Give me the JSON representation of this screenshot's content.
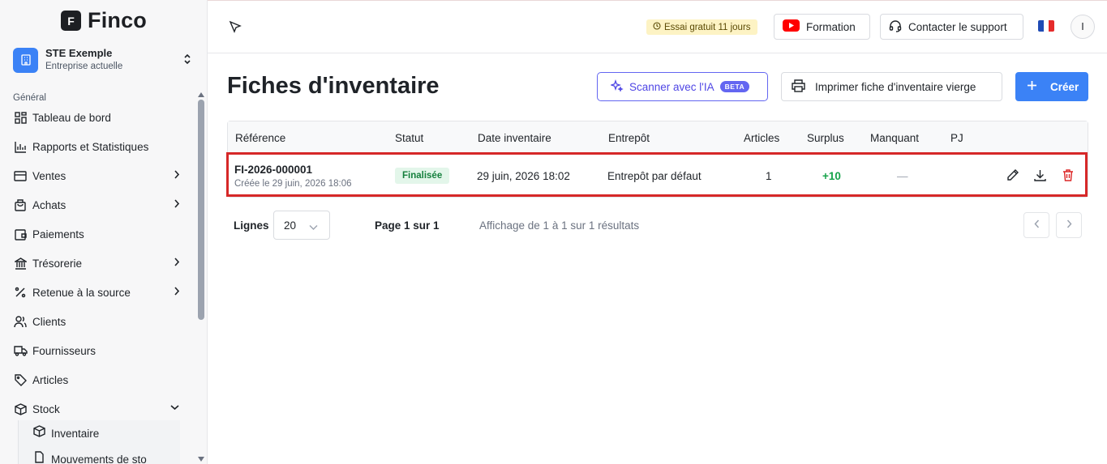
{
  "brand": {
    "logo_letter": "F",
    "name": "Finco"
  },
  "company": {
    "name": "STE Exemple",
    "subtitle": "Entreprise actuelle"
  },
  "sidebar": {
    "section": "Général",
    "items": [
      {
        "label": "Tableau de bord",
        "icon": "dashboard-icon",
        "has_chevron": false
      },
      {
        "label": "Rapports et Statistiques",
        "icon": "bar-chart-icon",
        "has_chevron": false
      },
      {
        "label": "Ventes",
        "icon": "card-icon",
        "has_chevron": true
      },
      {
        "label": "Achats",
        "icon": "bag-icon",
        "has_chevron": true
      },
      {
        "label": "Paiements",
        "icon": "wallet-icon",
        "has_chevron": false
      },
      {
        "label": "Trésorerie",
        "icon": "bank-icon",
        "has_chevron": true
      },
      {
        "label": "Retenue à la source",
        "icon": "percent-icon",
        "has_chevron": true
      },
      {
        "label": "Clients",
        "icon": "users-icon",
        "has_chevron": false
      },
      {
        "label": "Fournisseurs",
        "icon": "truck-icon",
        "has_chevron": false
      },
      {
        "label": "Articles",
        "icon": "tag-icon",
        "has_chevron": false
      },
      {
        "label": "Stock",
        "icon": "box-icon",
        "has_chevron": true,
        "expanded": true
      }
    ],
    "sub_items": [
      {
        "label": "Inventaire",
        "icon": "box-icon"
      },
      {
        "label": "Mouvements de sto",
        "icon": "file-icon"
      }
    ]
  },
  "topbar": {
    "trial": "Essai gratuit 11 jours",
    "formation": "Formation",
    "support": "Contacter le support",
    "avatar": "I",
    "flag_colors": [
      "#1f4bb5",
      "#ffffff",
      "#e52b2b"
    ]
  },
  "main": {
    "title": "Fiches d'inventaire",
    "scan_button": "Scanner avec l'IA",
    "beta": "BETA",
    "print_button": "Imprimer fiche d'inventaire vierge",
    "create_button": "Créer"
  },
  "table": {
    "columns": [
      "Référence",
      "Statut",
      "Date inventaire",
      "Entrepôt",
      "Articles",
      "Surplus",
      "Manquant",
      "PJ"
    ],
    "rows": [
      {
        "reference": "FI-2026-000001",
        "created": "Créée le 29 juin, 2026 18:06",
        "status": "Finalisée",
        "date": "29 juin, 2026 18:02",
        "warehouse": "Entrepôt par défaut",
        "articles": "1",
        "surplus": "+10",
        "missing": "—"
      }
    ]
  },
  "pagination": {
    "lines_label": "Lignes",
    "lines_value": "20",
    "page_info": "Page 1 sur 1",
    "results": "Affichage de 1 à 1 sur 1 résultats"
  },
  "colors": {
    "accent": "#3b82f6",
    "ai": "#6366f1",
    "highlight": "#d62828",
    "success": "#16a34a"
  }
}
